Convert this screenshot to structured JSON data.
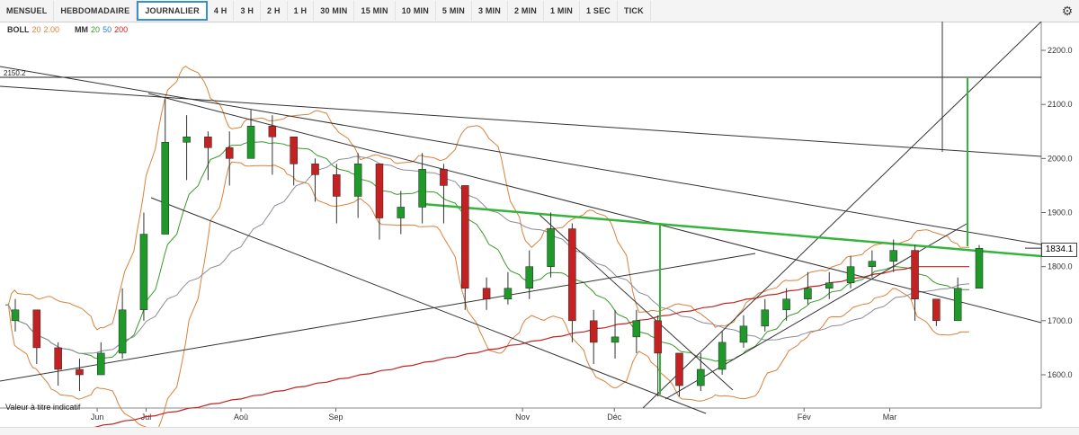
{
  "toolbar": {
    "timeframes": [
      "MENSUEL",
      "HEBDOMADAIRE",
      "JOURNALIER",
      "4 H",
      "3 H",
      "2 H",
      "1 H",
      "30 MIN",
      "15 MIN",
      "10 MIN",
      "5 MIN",
      "3 MIN",
      "2 MIN",
      "1 MIN",
      "1 SEC",
      "TICK"
    ],
    "active": "JOURNALIER",
    "settings_icon": "gear-icon"
  },
  "indicators": {
    "boll": {
      "name": "BOLL",
      "p1": "20",
      "p2": "2.00",
      "color": "#d9823b"
    },
    "mm": {
      "name": "MM",
      "p1": "20",
      "p2": "50",
      "p3": "200",
      "colors": [
        "#3a9a2a",
        "#2a7fd0",
        "#c22222"
      ]
    }
  },
  "disclaimer": "Valeur à titre indicatif",
  "chart_data": {
    "type": "candlestick",
    "x": [
      "2016-05-16",
      "2016-05-23",
      "2016-05-30",
      "2016-06-06",
      "2016-06-13",
      "2016-06-20",
      "2016-06-27",
      "2016-07-04",
      "2016-07-11",
      "2016-07-18",
      "2016-07-25",
      "2016-08-01",
      "2016-08-08",
      "2016-08-15",
      "2016-08-22",
      "2016-08-29",
      "2016-09-05",
      "2016-09-12",
      "2016-09-19",
      "2016-09-26",
      "2016-10-03",
      "2016-10-10",
      "2016-10-17",
      "2016-10-24",
      "2016-10-31",
      "2016-11-07",
      "2016-11-14",
      "2016-11-21",
      "2016-11-28",
      "2016-12-05",
      "2016-12-12",
      "2016-12-19",
      "2016-12-26",
      "2017-01-02",
      "2017-01-09",
      "2017-01-16",
      "2017-01-23",
      "2017-01-30",
      "2017-02-06",
      "2017-02-13",
      "2017-02-20",
      "2017-02-27",
      "2017-03-06",
      "2017-03-13",
      "2017-03-20",
      "2017-03-27"
    ],
    "close": [
      1720,
      1650,
      1610,
      1600,
      1640,
      1720,
      1860,
      2030,
      2040,
      2020,
      2000,
      2060,
      2040,
      1990,
      1970,
      1930,
      1990,
      1890,
      1910,
      1980,
      1950,
      1760,
      1740,
      1760,
      1800,
      1870,
      1700,
      1660,
      1670,
      1700,
      1640,
      1580,
      1610,
      1660,
      1690,
      1720,
      1740,
      1760,
      1770,
      1800,
      1810,
      1830,
      1740,
      1700,
      1760,
      1834
    ],
    "high": [
      1740,
      1720,
      1660,
      1630,
      1660,
      1760,
      1900,
      2110,
      2080,
      2050,
      2050,
      2090,
      2080,
      2040,
      2000,
      1990,
      2010,
      1950,
      1940,
      2010,
      1990,
      1920,
      1780,
      1790,
      1830,
      1900,
      1880,
      1720,
      1720,
      1720,
      1710,
      1640,
      1640,
      1680,
      1710,
      1740,
      1760,
      1790,
      1790,
      1820,
      1830,
      1850,
      1840,
      1730,
      1780,
      1840
    ],
    "low": [
      1680,
      1620,
      1580,
      1570,
      1600,
      1630,
      1700,
      1930,
      1960,
      1960,
      1950,
      2000,
      1970,
      1950,
      1920,
      1880,
      1890,
      1850,
      1860,
      1880,
      1880,
      1720,
      1720,
      1730,
      1740,
      1780,
      1660,
      1620,
      1630,
      1640,
      1560,
      1560,
      1570,
      1600,
      1650,
      1680,
      1700,
      1730,
      1740,
      1760,
      1780,
      1790,
      1700,
      1690,
      1720,
      1800
    ],
    "levels": [
      {
        "value": 2150.2,
        "label": "2150.2"
      }
    ],
    "last_price": "1834.1",
    "ylabel_ticks": [
      "1600.0",
      "1700.0",
      "1800.0",
      "1900.0",
      "2000.0",
      "2100.0",
      "2200.0"
    ],
    "xlabel_ticks": [
      "Jun",
      "Jul",
      "Aoû",
      "Sep",
      "Nov",
      "Déc",
      "Fév",
      "Mar"
    ],
    "ylim": [
      1530,
      2250
    ]
  }
}
